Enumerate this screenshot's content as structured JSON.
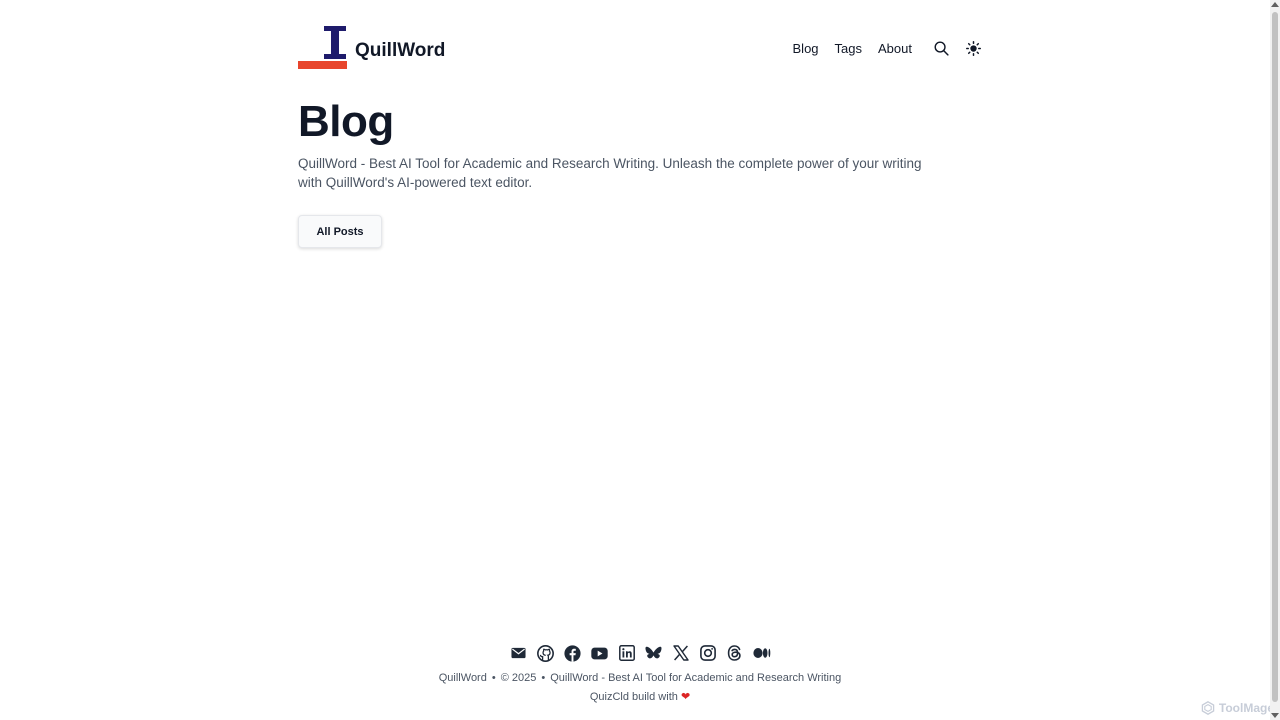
{
  "header": {
    "brand": "QuillWord",
    "nav": [
      {
        "label": "Blog"
      },
      {
        "label": "Tags"
      },
      {
        "label": "About"
      }
    ],
    "icons": [
      "search-icon",
      "sun-icon"
    ]
  },
  "main": {
    "title": "Blog",
    "description": "QuillWord - Best AI Tool for Academic and Research Writing. Unleash the complete power of your writing with QuillWord's AI-powered text editor.",
    "all_posts_label": "All Posts"
  },
  "footer": {
    "socials": [
      "mail-icon",
      "github-icon",
      "facebook-icon",
      "youtube-icon",
      "linkedin-icon",
      "bluesky-icon",
      "x-icon",
      "instagram-icon",
      "threads-icon",
      "medium-icon"
    ],
    "brand": "QuillWord",
    "copyright": "© 2025",
    "tagline": "QuillWord - Best AI Tool for Academic and Research Writing",
    "credit": "QuizCld build with",
    "heart": "❤"
  },
  "watermark": "ToolMage",
  "colors": {
    "logo_navy": "#1e1b6b",
    "logo_red": "#e8452c",
    "text": "#111827",
    "muted": "#4b5563"
  }
}
